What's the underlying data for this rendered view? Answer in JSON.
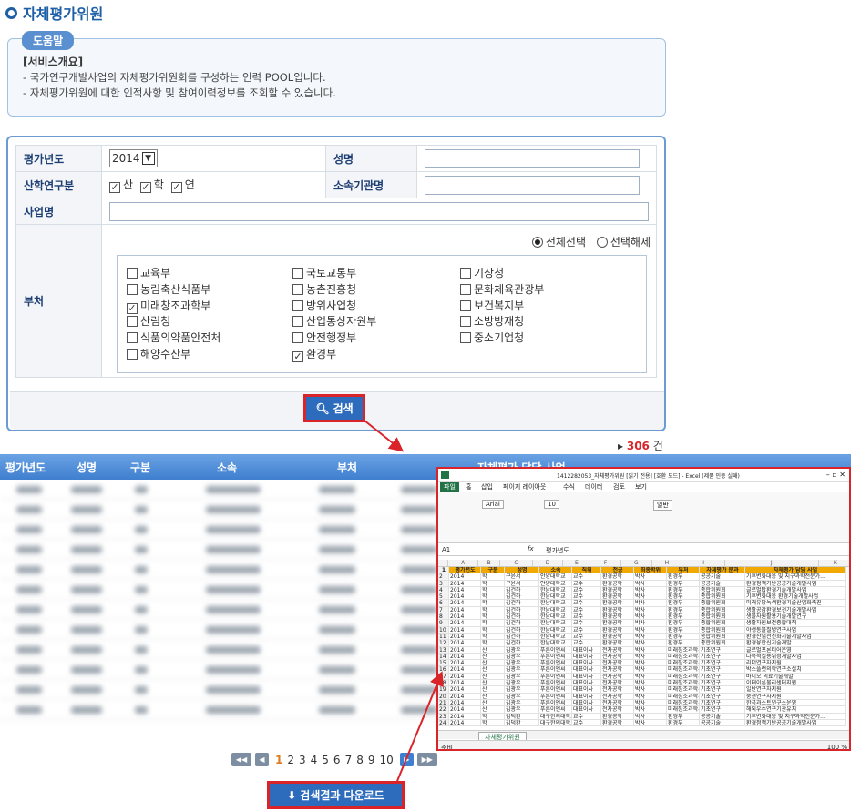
{
  "page": {
    "title": "자체평가위원"
  },
  "help": {
    "tag": "도움말",
    "heading": "[서비스개요]",
    "lines": [
      "- 국가연구개발사업의 자체평가위원회를 구성하는 인력 POOL입니다.",
      "- 자체평가위원에 대한 인적사항 및 참여이력정보를 조회할 수 있습니다."
    ]
  },
  "form": {
    "year_label": "평가년도",
    "year_value": "2014",
    "name_label": "성명",
    "type_label": "산학연구분",
    "types": [
      "산",
      "학",
      "연"
    ],
    "org_label": "소속기관명",
    "project_label": "사업명",
    "dept_label": "부처",
    "select_all": "전체선택",
    "deselect": "선택해제",
    "depts": [
      {
        "label": "교육부",
        "checked": false
      },
      {
        "label": "국토교통부",
        "checked": false
      },
      {
        "label": "기상청",
        "checked": false
      },
      {
        "label": "농림축산식품부",
        "checked": false
      },
      {
        "label": "농촌진흥청",
        "checked": false
      },
      {
        "label": "문화체육관광부",
        "checked": false
      },
      {
        "label": "미래창조과학부",
        "checked": true
      },
      {
        "label": "방위사업청",
        "checked": false
      },
      {
        "label": "보건복지부",
        "checked": false
      },
      {
        "label": "산림청",
        "checked": false
      },
      {
        "label": "산업통상자원부",
        "checked": false
      },
      {
        "label": "소방방재청",
        "checked": false
      },
      {
        "label": "식품의약품안전처",
        "checked": false
      },
      {
        "label": "안전행정부",
        "checked": false
      },
      {
        "label": "중소기업청",
        "checked": false
      },
      {
        "label": "해양수산부",
        "checked": false
      },
      {
        "label": "환경부",
        "checked": true
      }
    ],
    "search_button": "검색"
  },
  "results": {
    "count": "306",
    "count_unit": "건",
    "columns": [
      "평가년도",
      "성명",
      "구분",
      "소속",
      "부처",
      "자체평가 담당 사업"
    ]
  },
  "pager": {
    "pages": [
      "1",
      "2",
      "3",
      "4",
      "5",
      "6",
      "7",
      "8",
      "9",
      "10"
    ]
  },
  "download_button": "검색결과 다운로드",
  "excel": {
    "title": "1412282053_자체평가위원 [읽기 전용] [호환 모드] - Excel (제품 인증 실패)",
    "tabs": [
      "파일",
      "홈",
      "삽입",
      "페이지 레이아웃",
      "수식",
      "데이터",
      "검토",
      "보기"
    ],
    "cell_ref": "A1",
    "formula": "평가년도",
    "font": "Arial",
    "font_size": "10",
    "number_format": "일반",
    "col_letters": [
      "A",
      "B",
      "C",
      "D",
      "E",
      "F",
      "G",
      "H",
      "I",
      "J",
      "K"
    ],
    "headers": [
      "평가년도",
      "구분",
      "성명",
      "소속",
      "직위",
      "전공",
      "최종학위",
      "부처",
      "자체평가 분과",
      "자체평가 담당 사업"
    ],
    "rows": [
      [
        "2014",
        "학",
        "구윤서",
        "안양대학교",
        "교수",
        "환경공학",
        "박사",
        "환경부",
        "공공기술",
        "기후변화대응 및 지구과학전문가..."
      ],
      [
        "2014",
        "학",
        "구윤서",
        "안양대학교",
        "교수",
        "환경공학",
        "박사",
        "환경부",
        "공공기술",
        "환경정책기반공공기술개발사업"
      ],
      [
        "2014",
        "학",
        "김건하",
        "한남대학교",
        "교수",
        "환경공학",
        "박사",
        "환경부",
        "종합위원회",
        "글로벌탑환경기술개발사업"
      ],
      [
        "2014",
        "학",
        "김건하",
        "한남대학교",
        "교수",
        "환경공학",
        "박사",
        "환경부",
        "종합위원회",
        "기후변화대응 환경기술개발사업"
      ],
      [
        "2014",
        "학",
        "김건하",
        "한남대학교",
        "교수",
        "환경공학",
        "박사",
        "환경부",
        "종합위원회",
        "미래유망녹색환경기술산업화촉진"
      ],
      [
        "2014",
        "학",
        "김건하",
        "한남대학교",
        "교수",
        "환경공학",
        "박사",
        "환경부",
        "종합위원회",
        "생활공감환경보건기술개발사업"
      ],
      [
        "2014",
        "학",
        "김건하",
        "한남대학교",
        "교수",
        "환경공학",
        "박사",
        "환경부",
        "종합위원회",
        "생물자원활용기술개발연구"
      ],
      [
        "2014",
        "학",
        "김건하",
        "한남대학교",
        "교수",
        "환경공학",
        "박사",
        "환경부",
        "종합위원회",
        "생활자원보전종합대책"
      ],
      [
        "2014",
        "학",
        "김건하",
        "한남대학교",
        "교수",
        "환경공학",
        "박사",
        "환경부",
        "종합위원회",
        "야생동물질병연구사업"
      ],
      [
        "2014",
        "학",
        "김건하",
        "한남대학교",
        "교수",
        "환경공학",
        "박사",
        "환경부",
        "종합위원회",
        "환경산업선진화기술개발사업"
      ],
      [
        "2014",
        "학",
        "김건하",
        "한남대학교",
        "교수",
        "환경공학",
        "박사",
        "환경부",
        "종합위원회",
        "환경융합신기술개발"
      ],
      [
        "2014",
        "산",
        "김광우",
        "푸른이엔씨",
        "대표이사",
        "전자공학",
        "박사",
        "미래창조과학부",
        "기초연구",
        "글로벌프론티어운영"
      ],
      [
        "2014",
        "산",
        "김광우",
        "푸른이엔씨",
        "대표이사",
        "전자공학",
        "박사",
        "미래창조과학부",
        "기초연구",
        "다목적실용위성개발사업"
      ],
      [
        "2014",
        "산",
        "김광우",
        "푸른이엔씨",
        "대표이사",
        "전자공학",
        "박사",
        "미래창조과학부",
        "기초연구",
        "리더연구자지원"
      ],
      [
        "2014",
        "산",
        "김광우",
        "푸른이엔씨",
        "대표이사",
        "전자공학",
        "박사",
        "미래창조과학부",
        "기초연구",
        "박스플랫의학연구소설치"
      ],
      [
        "2014",
        "산",
        "김광우",
        "푸른이엔씨",
        "대표이사",
        "전자공학",
        "박사",
        "미래창조과학부",
        "기초연구",
        "바이오 의료기술개발"
      ],
      [
        "2014",
        "산",
        "김광우",
        "푸른이엔씨",
        "대표이사",
        "전자공학",
        "박사",
        "미래창조과학부",
        "기초연구",
        "이태이론물리센터지원"
      ],
      [
        "2014",
        "산",
        "김광우",
        "푸른이엔씨",
        "대표이사",
        "전자공학",
        "박사",
        "미래창조과학부",
        "기초연구",
        "일반연구자지원"
      ],
      [
        "2014",
        "산",
        "김광우",
        "푸른이엔씨",
        "대표이사",
        "전자공학",
        "박사",
        "미래창조과학부",
        "기초연구",
        "중견연구자지원"
      ],
      [
        "2014",
        "산",
        "김광우",
        "푸른이엔씨",
        "대표이사",
        "전자공학",
        "박사",
        "미래창조과학부",
        "기초연구",
        "한국과스트연구소운영"
      ],
      [
        "2014",
        "산",
        "김광우",
        "푸른이엔씨",
        "대표이사",
        "전자공학",
        "박사",
        "미래창조과학부",
        "기초연구",
        "해외우수연구기관유치"
      ],
      [
        "2014",
        "학",
        "김덕환",
        "대구한의대학교",
        "교수",
        "환경공학",
        "박사",
        "환경부",
        "공공기술",
        "기후변화대응 및 지구과학전문가..."
      ],
      [
        "2014",
        "학",
        "김덕환",
        "대구한의대학교",
        "교수",
        "환경공학",
        "박사",
        "환경부",
        "공공기술",
        "환경정책기반공공기술개발사업"
      ]
    ],
    "sheet_tab": "자체평가위원",
    "status_left": "준비",
    "zoom": "100 %"
  }
}
